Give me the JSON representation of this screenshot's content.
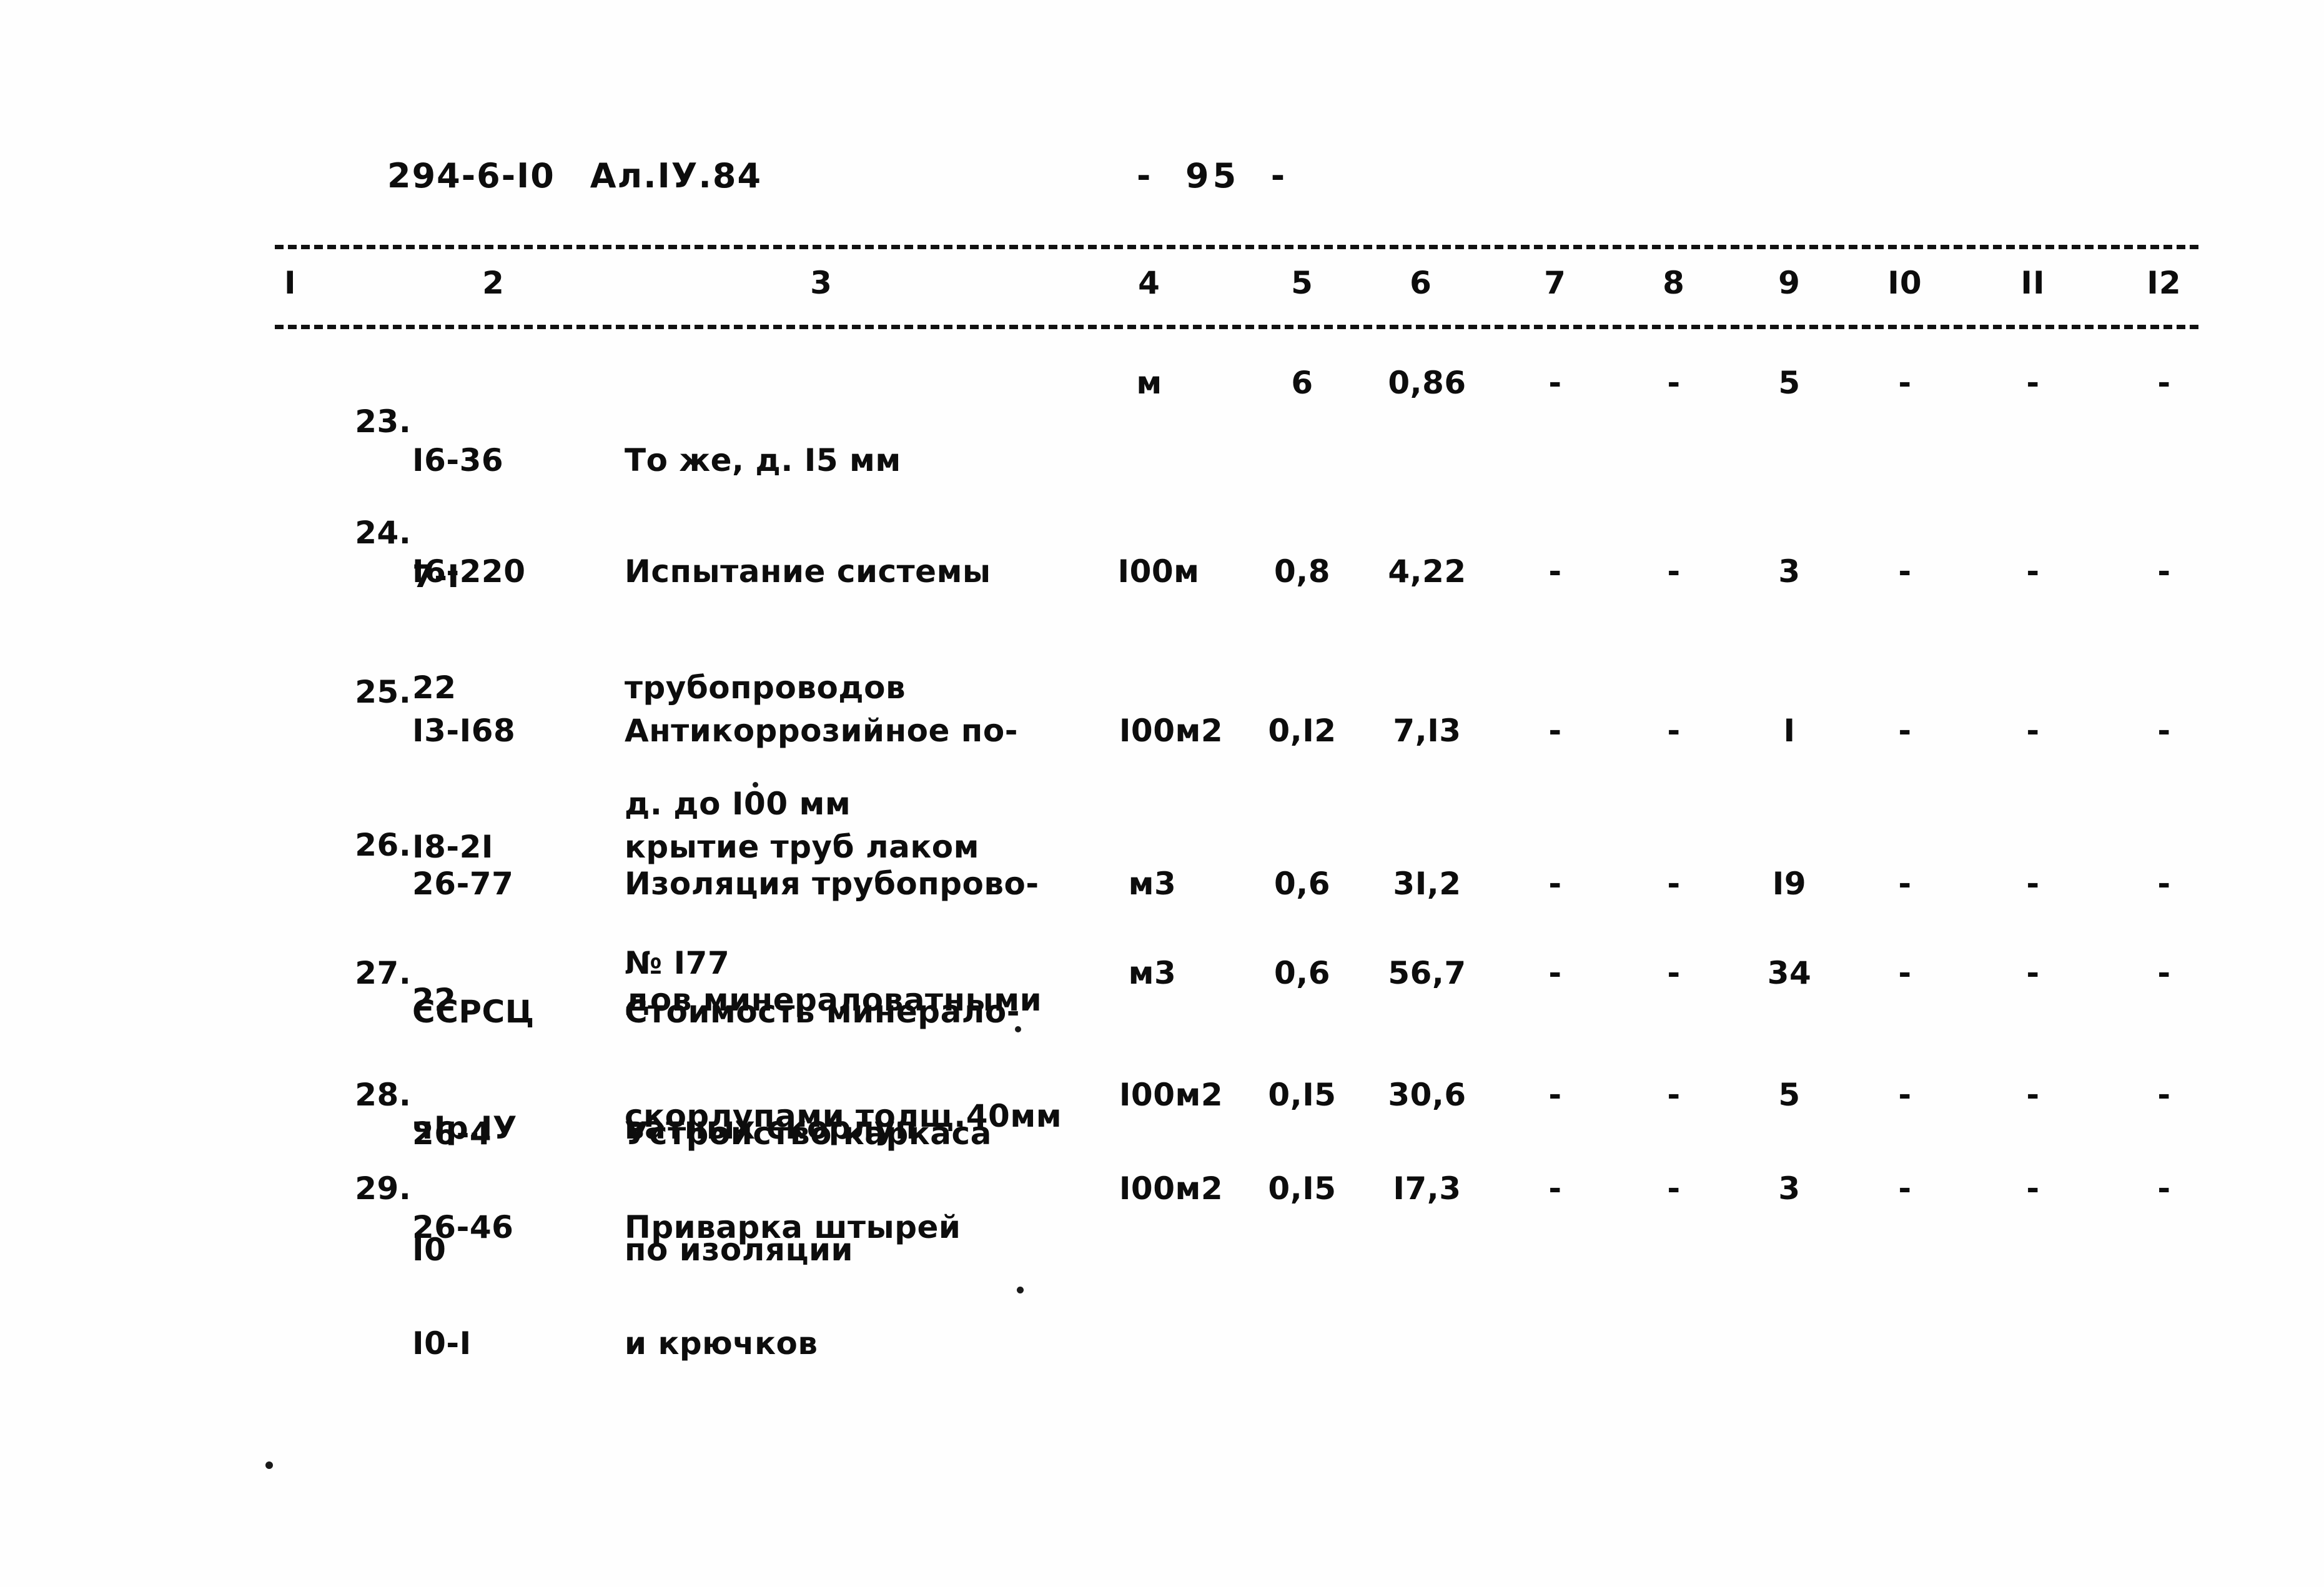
{
  "header": {
    "doc_code": "294-6-I0",
    "album": "Ал.IУ.84",
    "page_marker": "-  95  -"
  },
  "table": {
    "column_numbers": [
      "I",
      "2",
      "3",
      "4",
      "5",
      "6",
      "7",
      "8",
      "9",
      "I0",
      "II",
      "I2"
    ],
    "rows": [
      {
        "no": "23.",
        "code_lines": [
          "I6-36",
          "7-I"
        ],
        "desc_lines": [
          "То же, д. I5 мм"
        ],
        "unit": "м",
        "c5": "6",
        "c6": "0,86",
        "c7": "-",
        "c8": "-",
        "c9": "5",
        "c10": "-",
        "c11": "-",
        "c12": "-"
      },
      {
        "no": "24.",
        "code_lines": [
          "I6-220",
          "22"
        ],
        "desc_lines": [
          "Испытание системы",
          "трубопроводов",
          "д. до I00 мм"
        ],
        "unit": "I00м",
        "c5": "0,8",
        "c6": "4,22",
        "c7": "-",
        "c8": "-",
        "c9": "3",
        "c10": "-",
        "c11": "-",
        "c12": "-"
      },
      {
        "no": "25.",
        "code_lines": [
          "I3-I68",
          "I8-2I"
        ],
        "desc_lines": [
          "Антикоррозийное по-",
          "крытие труб лаком",
          "№ I77"
        ],
        "unit": "I00м2",
        "c5": "0,I2",
        "c6": "7,I3",
        "c7": "-",
        "c8": "-",
        "c9": "I",
        "c10": "-",
        "c11": "-",
        "c12": "-"
      },
      {
        "no": "26.",
        "code_lines": [
          "26-77",
          "22"
        ],
        "desc_lines": [
          "Изоляция трубопрово-",
          "дов минераловатными",
          "скорлупами толщ.40мм"
        ],
        "unit": "м3",
        "c5": "0,6",
        "c6": "3I,2",
        "c7": "-",
        "c8": "-",
        "c9": "I9",
        "c10": "-",
        "c11": "-",
        "c12": "-"
      },
      {
        "no": "27.",
        "code_lines": [
          "ССРСЦ",
          "чIр.IУ"
        ],
        "desc_lines": [
          "Стоимость минерало-",
          "ватных скорлуп"
        ],
        "unit": "м3",
        "c5": "0,6",
        "c6": "56,7",
        "c7": "-",
        "c8": "-",
        "c9": "34",
        "c10": "-",
        "c11": "-",
        "c12": "-"
      },
      {
        "no": "28.",
        "code_lines": [
          "26-4",
          "I0"
        ],
        "desc_lines": [
          "Устройство каркаса",
          "по изоляции"
        ],
        "unit": "I00м2",
        "c5": "0,I5",
        "c6": "30,6",
        "c7": "-",
        "c8": "-",
        "c9": "5",
        "c10": "-",
        "c11": "-",
        "c12": "-"
      },
      {
        "no": "29.",
        "code_lines": [
          "26-46",
          "I0-I"
        ],
        "desc_lines": [
          "Приварка штырей",
          "и крючков"
        ],
        "unit": "I00м2",
        "c5": "0,I5",
        "c6": "I7,3",
        "c7": "-",
        "c8": "-",
        "c9": "3",
        "c10": "-",
        "c11": "-",
        "c12": "-"
      }
    ]
  }
}
